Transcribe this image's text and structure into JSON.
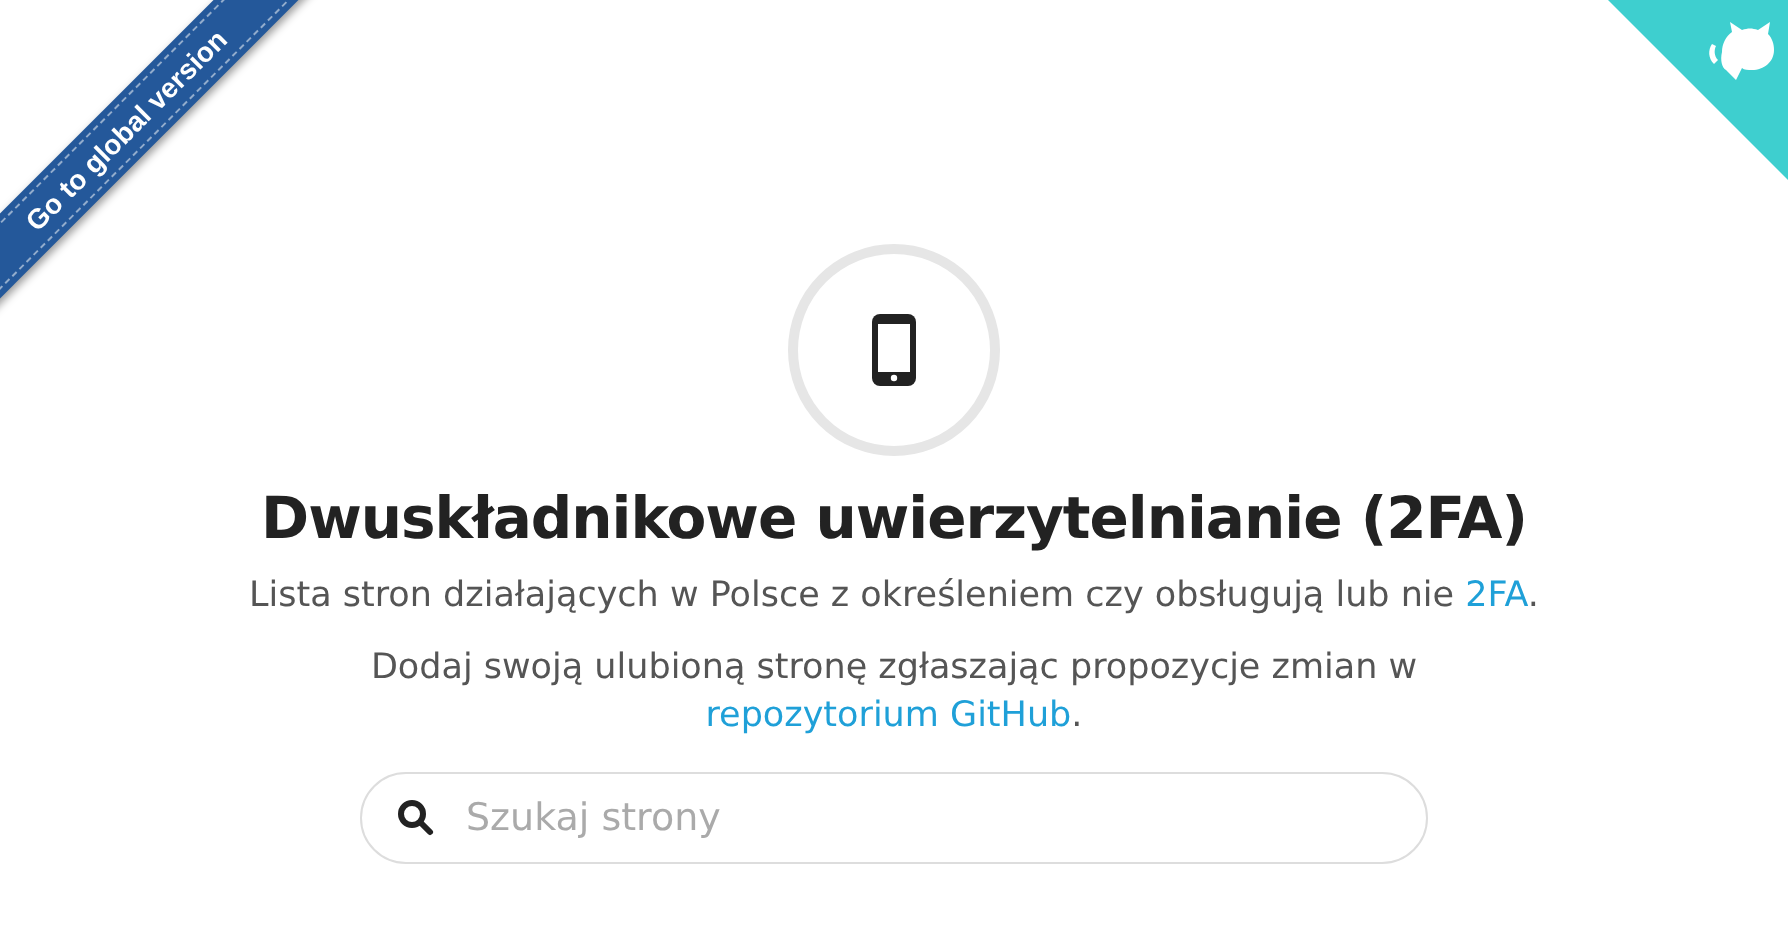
{
  "ribbon": {
    "label": "Go to global version"
  },
  "title": "Dwuskładnikowe uwierzytelnianie (2FA)",
  "paragraphs": [
    {
      "parts": [
        {
          "kind": "text",
          "text": "Lista stron działających w Polsce z określeniem czy obsługują lub nie "
        },
        {
          "kind": "link",
          "text": "2FA"
        },
        {
          "kind": "text",
          "text": "."
        }
      ]
    },
    {
      "parts": [
        {
          "kind": "text",
          "text": "Dodaj swoją ulubioną stronę zgłaszając propozycje zmian w "
        },
        {
          "kind": "link",
          "text": "repozytorium GitHub"
        },
        {
          "kind": "text",
          "text": "."
        }
      ]
    }
  ],
  "search": {
    "placeholder": "Szukaj strony"
  }
}
